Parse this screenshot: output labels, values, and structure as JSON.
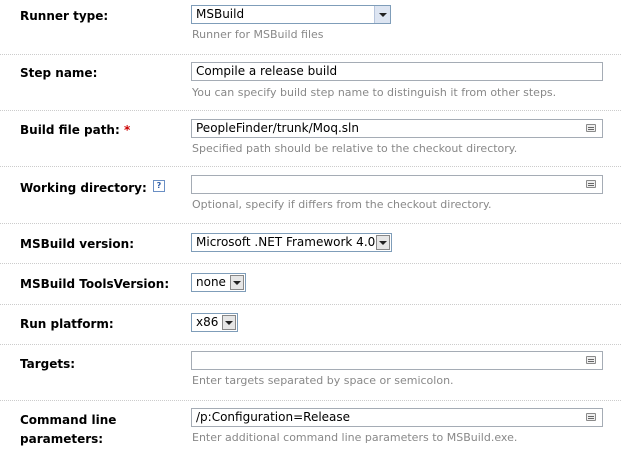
{
  "fields": {
    "runner_type": {
      "label": "Runner type:",
      "value": "MSBuild",
      "note": "Runner for MSBuild files"
    },
    "step_name": {
      "label": "Step name:",
      "value": "Compile a release build",
      "note": "You can specify build step name to distinguish it from other steps."
    },
    "build_file_path": {
      "label": "Build file path:",
      "required_mark": "*",
      "value": "PeopleFinder/trunk/Moq.sln",
      "note": "Specified path should be relative to the checkout directory."
    },
    "working_directory": {
      "label": "Working directory:",
      "help_glyph": "?",
      "value": "",
      "note": "Optional, specify if differs from the checkout directory."
    },
    "msbuild_version": {
      "label": "MSBuild version:",
      "value": "Microsoft .NET Framework 4.0"
    },
    "tools_version": {
      "label": "MSBuild ToolsVersion:",
      "value": "none"
    },
    "run_platform": {
      "label": "Run platform:",
      "value": "x86"
    },
    "targets": {
      "label": "Targets:",
      "value": "",
      "note": "Enter targets separated by space or semicolon."
    },
    "command_line": {
      "label_line1": "Command line",
      "label_line2": "parameters:",
      "value": "/p:Configuration=Release",
      "note": "Enter additional command line parameters to MSBuild.exe."
    }
  },
  "colors": {
    "required": "#cc0000",
    "note": "#888888",
    "border": "#a5acb5",
    "divider": "#cccccc"
  },
  "icons": {
    "picker": "file-tree-picker-icon",
    "dropdown": "chevron-down-icon",
    "help": "help-icon"
  }
}
